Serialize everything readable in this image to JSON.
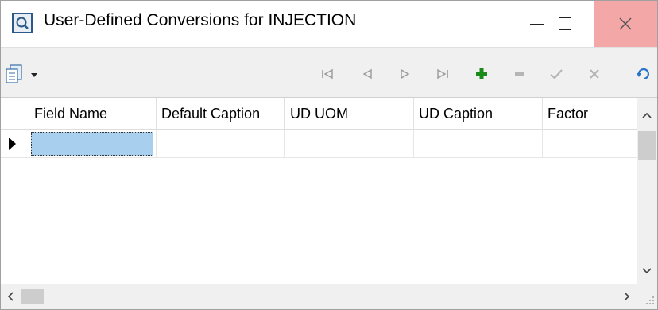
{
  "window": {
    "title": "User-Defined Conversions for INJECTION",
    "app_icon": "query-app-icon",
    "caption_buttons": {
      "minimize": "minimize-icon",
      "maximize": "maximize-icon",
      "close": "close-icon",
      "close_bg": "#f4a7a7"
    }
  },
  "toolbar": {
    "menu_icon": "document-menu-icon",
    "nav": [
      {
        "name": "first-record",
        "glyph": "⏮",
        "color": "#9a9a9a"
      },
      {
        "name": "prior-record",
        "glyph": "◁",
        "color": "#9a9a9a"
      },
      {
        "name": "next-record",
        "glyph": "▷",
        "color": "#9a9a9a"
      },
      {
        "name": "last-record",
        "glyph": "⏭",
        "color": "#9a9a9a"
      },
      {
        "name": "insert-record",
        "glyph": "+",
        "color": "#1a8a1a"
      },
      {
        "name": "delete-record",
        "glyph": "—",
        "color": "#9a9a9a"
      },
      {
        "name": "post-edit",
        "glyph": "✓",
        "color": "#9a9a9a"
      },
      {
        "name": "cancel-edit",
        "glyph": "✕",
        "color": "#9a9a9a"
      },
      {
        "name": "refresh-data",
        "glyph": "⟳",
        "color": "#2a72c8"
      }
    ]
  },
  "grid": {
    "columns": [
      {
        "label": "Field Name"
      },
      {
        "label": "Default Caption"
      },
      {
        "label": "UD UOM"
      },
      {
        "label": "UD Caption"
      },
      {
        "label": "Factor"
      }
    ],
    "rows": [
      {
        "field_name": "",
        "default_caption": "",
        "ud_uom": "",
        "ud_caption": "",
        "factor": ""
      }
    ],
    "active_cell_color": "#a9cfee"
  },
  "scrollbars": {
    "up": "▲",
    "down": "▼",
    "left": "<",
    "right": ">"
  }
}
